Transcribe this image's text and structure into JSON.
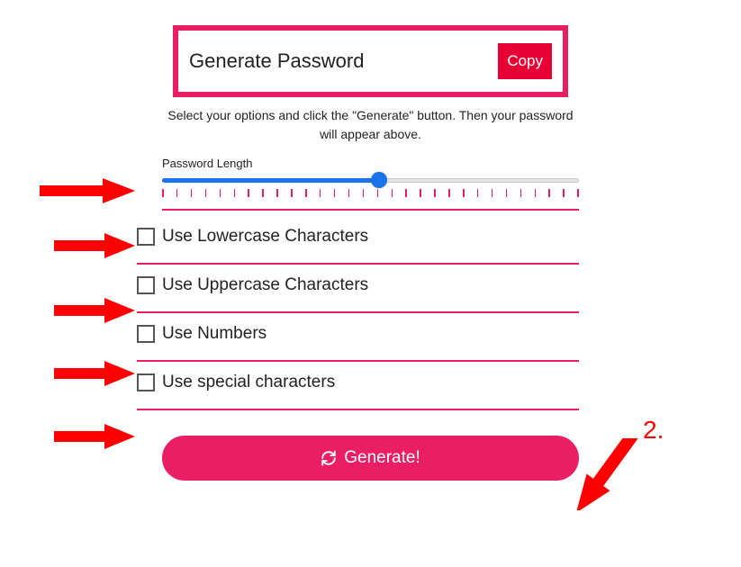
{
  "password_display": {
    "text": "Generate Password",
    "copy_label": "Copy"
  },
  "instructions": "Select your options and click the \"Generate\" button. Then your password will appear above.",
  "slider": {
    "label": "Password Length",
    "min": 0,
    "max": 30,
    "value": 16
  },
  "options": [
    {
      "label": "Use Lowercase Characters",
      "checked": false
    },
    {
      "label": "Use Uppercase Characters",
      "checked": false
    },
    {
      "label": "Use Numbers",
      "checked": false
    },
    {
      "label": "Use special characters",
      "checked": false
    }
  ],
  "generate_label": "Generate!",
  "annotations": {
    "step2_label": "2."
  },
  "colors": {
    "accent": "#ea1e63",
    "copy_btn": "#e60033",
    "slider_fill": "#1a73e8",
    "annotation": "#ff0000"
  }
}
